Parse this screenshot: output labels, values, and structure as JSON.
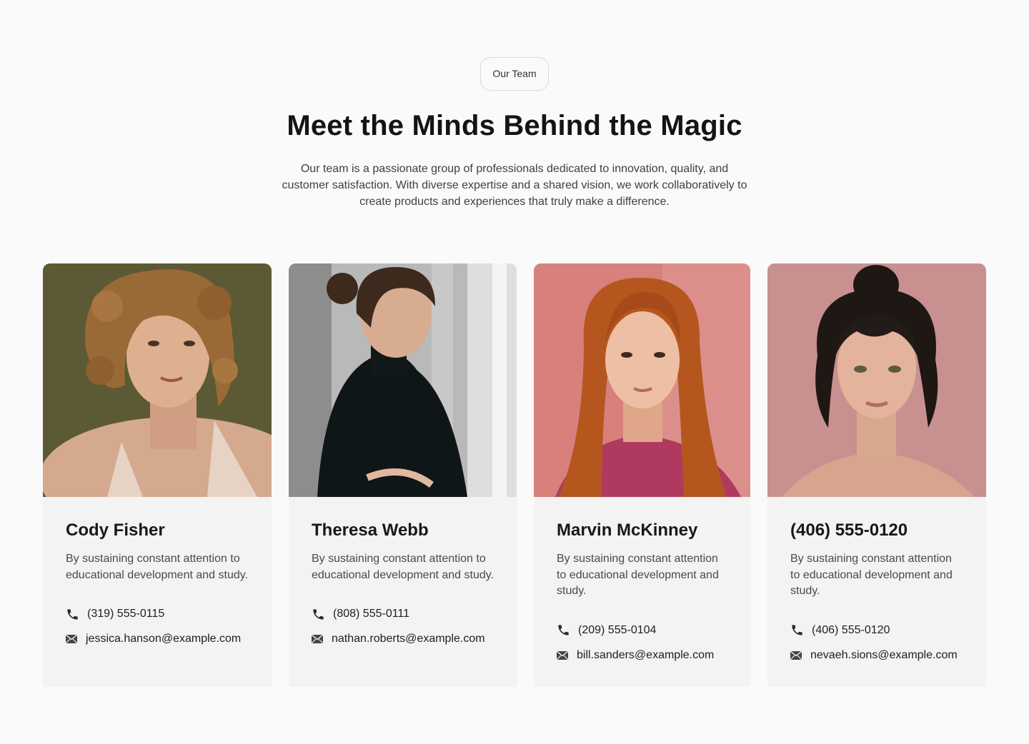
{
  "header": {
    "badge": "Our Team",
    "title": "Meet the Minds Behind the Magic",
    "description": "Our team is a passionate group of professionals dedicated to innovation, quality, and customer satisfaction. With diverse expertise and a shared vision, we work collaboratively to create products and experiences that truly make a difference."
  },
  "icons": {
    "phone": "phone-icon",
    "email": "mail-icon"
  },
  "members": [
    {
      "name": "Cody Fisher",
      "bio": "By sustaining constant attention to educational development and study.",
      "phone": "(319) 555-0115",
      "email": "jessica.hanson@example.com",
      "photo_bg": "#5b5a34"
    },
    {
      "name": "Theresa Webb",
      "bio": "By sustaining constant attention to educational development and study.",
      "phone": "(808) 555-0111",
      "email": "nathan.roberts@example.com",
      "photo_bg": "#b9b9b9"
    },
    {
      "name": "Marvin McKinney",
      "bio": "By sustaining constant attention to educational development and study.",
      "phone": "(209) 555-0104",
      "email": "bill.sanders@example.com",
      "photo_bg": "#d7807c"
    },
    {
      "name": "(406) 555-0120",
      "bio": "By sustaining constant attention to educational development and study.",
      "phone": "(406) 555-0120",
      "email": "nevaeh.sions@example.com",
      "photo_bg": "#c99090"
    }
  ]
}
